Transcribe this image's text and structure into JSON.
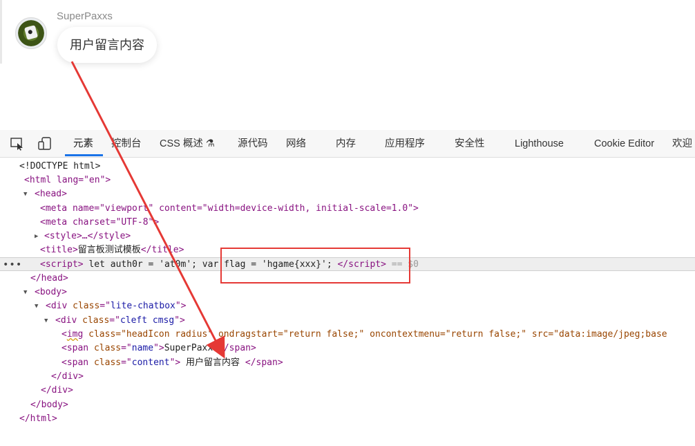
{
  "chat": {
    "username": "SuperPaxxs",
    "message": "用户留言内容"
  },
  "devtools": {
    "tabs": [
      "元素",
      "控制台",
      "CSS 概述 ⚗",
      "源代码",
      "网络",
      "内存",
      "应用程序",
      "安全性",
      "Lighthouse",
      "Cookie Editor",
      "欢迎"
    ],
    "active_tab": "元素",
    "icons": [
      "inspect-element-icon",
      "device-toolbar-icon"
    ],
    "dom": {
      "doctype": "<!DOCTYPE html>",
      "html_open": "<html lang=\"en\">",
      "head_open": "<head>",
      "meta_viewport": "<meta name=\"viewport\" content=\"width=device-width, initial-scale=1.0\">",
      "meta_charset": "<meta charset=\"UTF-8\">",
      "style": "<style>…</style>",
      "title_text": "留言板测试模板",
      "script_content": " let auth0r = 'at0m'; var flag = 'hgame{xxx}'; ",
      "selected_marker": "== $0",
      "head_close": "</head>",
      "body_open": "<body>",
      "div_chatbox_class": "lite-chatbox",
      "div_cleft_class": "cleft cmsg",
      "img_attrs": "class=\"headIcon radius\" ondragstart=\"return false;\" oncontextmenu=\"return false;\" src=\"data:image/jpeg;base",
      "span_name_class": "name",
      "span_name_text": "SuperPaxxs",
      "span_content_class": "content",
      "span_content_text": " 用户留言内容 ",
      "div_close": "</div>",
      "body_close": "</body>",
      "html_close": "</html>"
    }
  },
  "annotation": {
    "box_color": "#e53935",
    "arrow_color": "#e53935"
  }
}
